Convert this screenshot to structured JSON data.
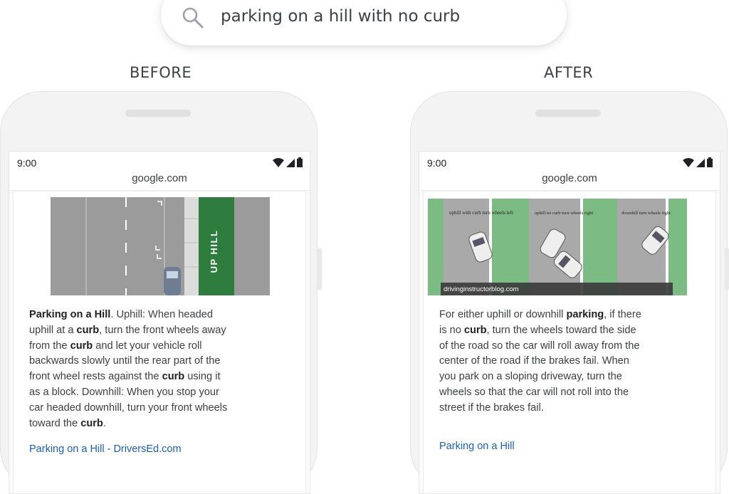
{
  "search": {
    "query": "parking on a hill with no curb",
    "icon": "search-icon"
  },
  "labels": {
    "before": "BEFORE",
    "after": "AFTER"
  },
  "before": {
    "status_time": "9:00",
    "url": "google.com",
    "image_text": "UP HILL",
    "snippet": [
      {
        "b": "Parking on a Hill",
        "t": ". Uphill: When headed"
      },
      {
        "t": "uphill at a "
      },
      {
        "b": "curb"
      },
      {
        "t": ", turn the front wheels away"
      }
    ],
    "snippet_lines": [
      [
        {
          "b": "Parking on a Hill"
        },
        {
          "t": ". Uphill: When headed"
        }
      ],
      [
        {
          "t": "uphill at a "
        },
        {
          "b": "curb"
        },
        {
          "t": ", turn the front wheels away"
        }
      ],
      [
        {
          "t": "from the "
        },
        {
          "b": "curb"
        },
        {
          "t": " and let your vehicle roll"
        }
      ],
      [
        {
          "t": "backwards slowly until the rear part of the"
        }
      ],
      [
        {
          "t": "front wheel rests against the "
        },
        {
          "b": "curb"
        },
        {
          "t": " using it"
        }
      ],
      [
        {
          "t": "as a block. Downhill: When you stop your"
        }
      ],
      [
        {
          "t": "car headed downhill, turn your front wheels"
        }
      ],
      [
        {
          "t": "toward the "
        },
        {
          "b": "curb"
        },
        {
          "t": "."
        }
      ]
    ],
    "link": "Parking on a Hill - DriversEd.com"
  },
  "after": {
    "status_time": "9:00",
    "url": "google.com",
    "image_captions": [
      "uphill with curb turn wheels left",
      "uphill no curb turn wheels right",
      "downhill turn wheels right"
    ],
    "image_credit": "drivinginstructorblog.com",
    "snippet_lines": [
      [
        {
          "t": "For either uphill or downhill "
        },
        {
          "b": "parking"
        },
        {
          "t": ", if there"
        }
      ],
      [
        {
          "t": "is no "
        },
        {
          "b": "curb"
        },
        {
          "t": ", turn the wheels toward the side"
        }
      ],
      [
        {
          "t": "of the road so the car will roll away from the"
        }
      ],
      [
        {
          "t": "center of the road if the brakes fail. When"
        }
      ],
      [
        {
          "t": "you park on a sloping driveway, turn the"
        }
      ],
      [
        {
          "t": "wheels so that the car will not roll into the"
        }
      ],
      [
        {
          "t": "street if the brakes fail."
        }
      ]
    ],
    "link": "Parking on a Hill"
  },
  "colors": {
    "link": "#1a5fb4",
    "road": "#9a9a9a",
    "green": "#2e7d3f",
    "lightgreen": "#7dbb84"
  }
}
